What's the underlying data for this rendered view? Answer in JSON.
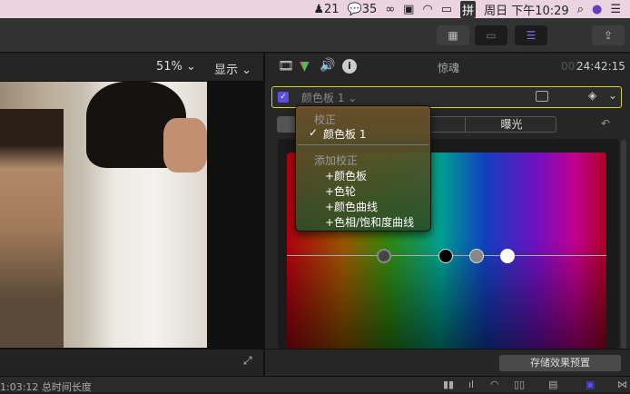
{
  "menubar": {
    "qq_count": "21",
    "wechat_count": "35",
    "input_method": "拼",
    "clock": "周日 下午10:29"
  },
  "viewer": {
    "zoom": "51%",
    "display_menu": "显示"
  },
  "inspector": {
    "clip_name": "惊魂",
    "timecode_dim": "00:",
    "timecode": "24:42:15",
    "correction_name": "颜色板 1",
    "tab_label": "曝光",
    "save_preset": "存储效果预置"
  },
  "dropdown": {
    "section1": "校正",
    "selected": "颜色板 1",
    "section2": "添加校正",
    "items": [
      "+颜色板",
      "+色轮",
      "+颜色曲线",
      "+色相/饱和度曲线"
    ]
  },
  "status": {
    "duration": "1:03:12 总时间长度"
  },
  "colors": {
    "accent": "#5b4de0",
    "highlight": "#d9cf3a"
  }
}
